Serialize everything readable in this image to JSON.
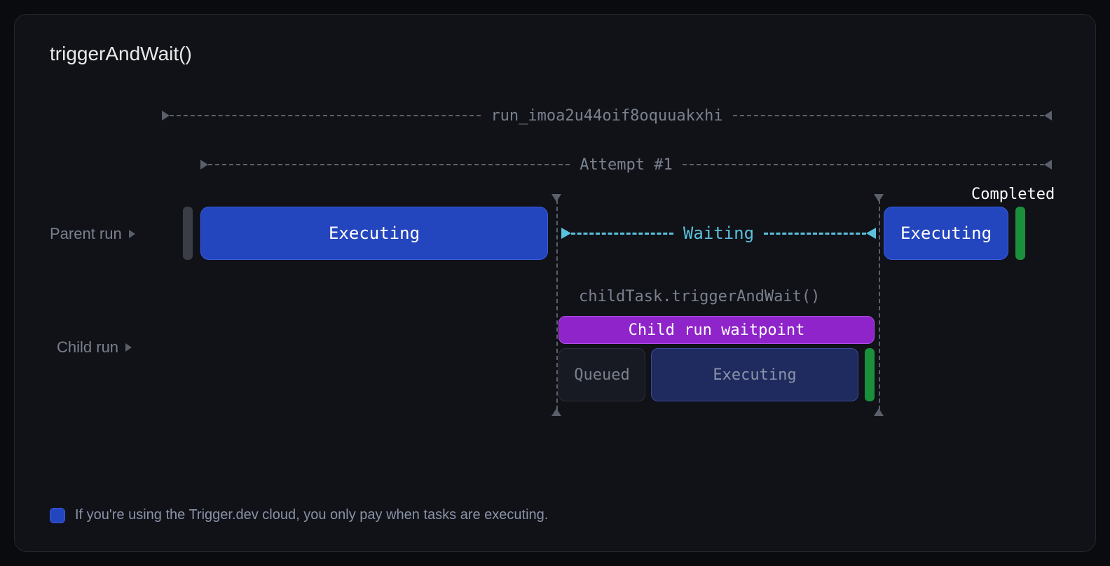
{
  "title": "triggerAndWait()",
  "run": {
    "id": "run_imoa2u44oif8oquuakxhi",
    "attempt": "Attempt #1"
  },
  "parent": {
    "label": "Parent run",
    "executing1": "Executing",
    "waiting": "Waiting",
    "executing2": "Executing",
    "completed": "Completed"
  },
  "child": {
    "label": "Child run",
    "call": "childTask.triggerAndWait()",
    "waitpoint": "Child run waitpoint",
    "queued": "Queued",
    "executing": "Executing"
  },
  "footer": "If you're using the Trigger.dev cloud, you only pay when tasks are executing.",
  "colors": {
    "accent": "#2345be",
    "waitpoint": "#8e24c9",
    "waiting": "#5bc0de",
    "success": "#1a8f3c"
  }
}
